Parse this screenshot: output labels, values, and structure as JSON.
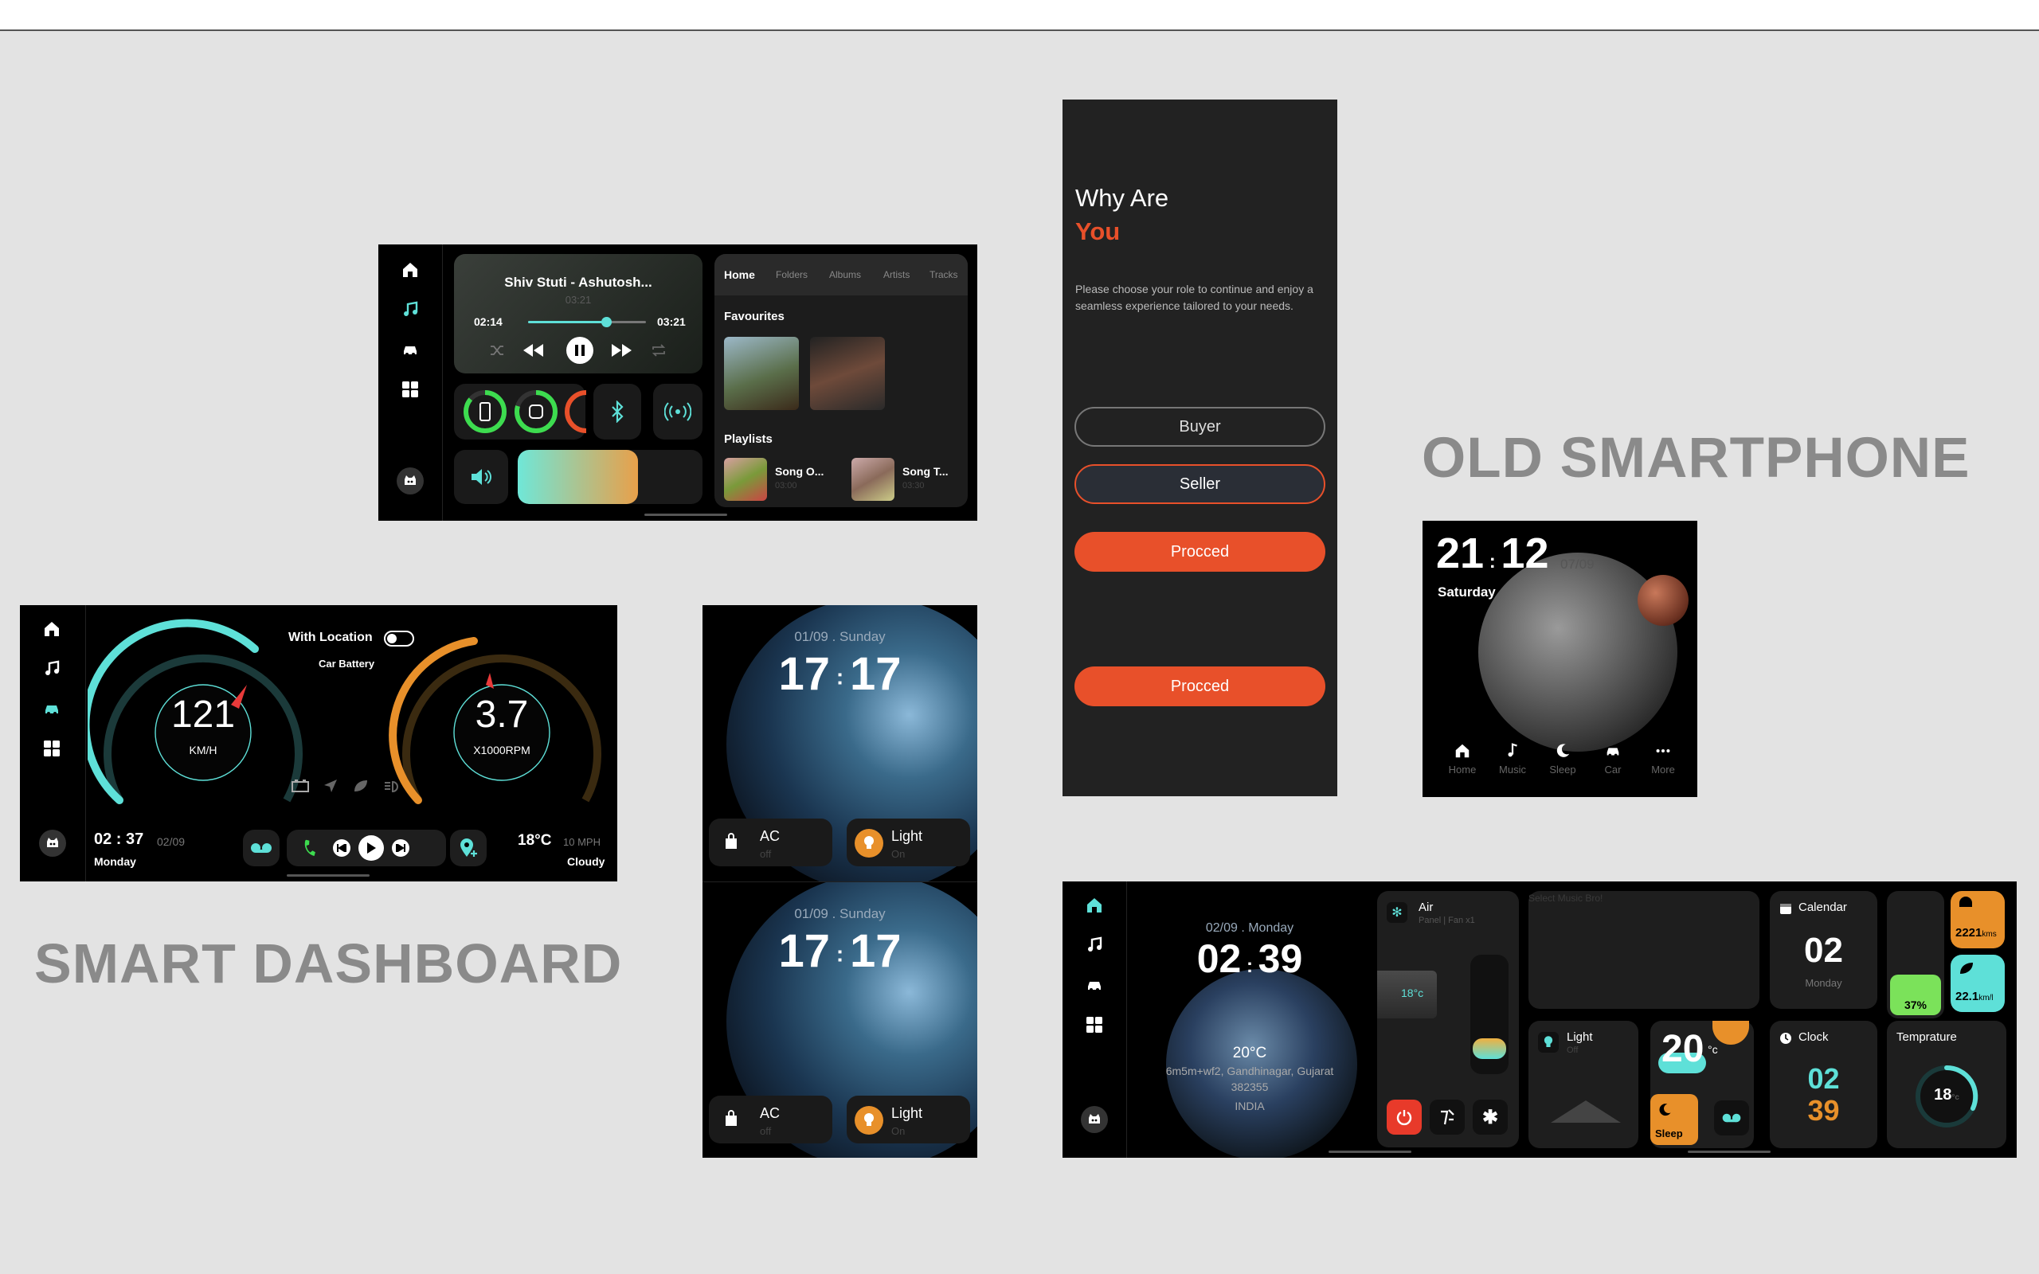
{
  "labels": {
    "smart_dashboard": "SMART DASHBOARD",
    "old_smartphone": "OLD SMARTPHONE"
  },
  "music": {
    "song_title": "Shiv Stuti - Ashutosh...",
    "total": "03:21",
    "elapsed": "02:14",
    "remaining": "03:21",
    "progress": 0.66,
    "tabs": [
      "Home",
      "Folders",
      "Albums",
      "Artists",
      "Tracks"
    ],
    "favourites_heading": "Favourites",
    "playlists_heading": "Playlists",
    "playlists": [
      {
        "title": "Song O...",
        "time": "03:00"
      },
      {
        "title": "Song T...",
        "time": "03:30"
      }
    ],
    "volume": 0.65
  },
  "car": {
    "location_label": "With Location",
    "battery_label": "Car Battery",
    "speed": "121",
    "speed_unit": "KM/H",
    "rpm": "3.7",
    "rpm_unit": "X1000RPM",
    "time_h": "02",
    "time_m": "37",
    "date": "02/09",
    "day": "Monday",
    "temp": "18°C",
    "wind": "10 MPH",
    "weather": "Cloudy"
  },
  "earth_widgets": [
    {
      "date": "01/09 . Sunday",
      "h": "17",
      "m": "17",
      "ac_label": "AC",
      "ac_state": "off",
      "light_label": "Light",
      "light_state": "On"
    },
    {
      "date": "01/09 . Sunday",
      "h": "17",
      "m": "17",
      "ac_label": "AC",
      "ac_state": "off",
      "light_label": "Light",
      "light_state": "On"
    }
  ],
  "role": {
    "heading1": "Why Are",
    "heading2": "You",
    "description": "Please choose your role to continue and enjoy a seamless experience tailored to your needs.",
    "buyer": "Buyer",
    "seller": "Seller",
    "proceed1": "Procced",
    "proceed2": "Procced",
    "accent": "#e8502a"
  },
  "phone": {
    "h": "21",
    "m": "12",
    "date": "07/09",
    "day": "Saturday",
    "nav": [
      "Home",
      "Music",
      "Sleep",
      "Car",
      "More"
    ]
  },
  "home": {
    "date": "02/09 . Monday",
    "h": "02",
    "m": "39",
    "temp": "20°C",
    "address": "6m5m+wf2, Gandhinagar, Gujarat",
    "zip": "382355",
    "country": "INDIA",
    "air_title": "Air",
    "air_sub": "Panel | Fan x1",
    "ac_temp": "18°c",
    "music_placeholder": "Select Music Bro!",
    "light_title": "Light",
    "light_state": "Off",
    "weather_temp": "20",
    "weather_unit": "°c",
    "sleep": "Sleep",
    "calendar_title": "Calendar",
    "calendar_day": "02",
    "calendar_weekday": "Monday",
    "battery": "37%",
    "distance1": "2221",
    "distance1_unit": "kms",
    "distance2": "22.1",
    "distance2_unit": "km/l",
    "clock_title": "Clock",
    "clock_h": "02",
    "clock_m": "39",
    "temperature_title": "Temprature",
    "temperature_value": "18",
    "temperature_unit": "°c"
  }
}
